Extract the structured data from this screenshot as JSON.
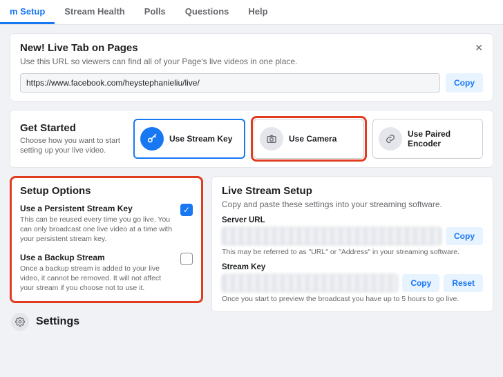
{
  "tabs": {
    "items": [
      {
        "label": "m Setup",
        "active": true
      },
      {
        "label": "Stream Health",
        "active": false
      },
      {
        "label": "Polls",
        "active": false
      },
      {
        "label": "Questions",
        "active": false
      },
      {
        "label": "Help",
        "active": false
      }
    ]
  },
  "live_tab_card": {
    "title": "New! Live Tab on Pages",
    "subtitle": "Use this URL so viewers can find all of your Page's live videos in one place.",
    "url": "https://www.facebook.com/heystephanieliu/live/",
    "copy_label": "Copy"
  },
  "get_started": {
    "title": "Get Started",
    "subtitle": "Choose how you want to start setting up your live video.",
    "options": [
      {
        "label": "Use Stream Key"
      },
      {
        "label": "Use Camera"
      },
      {
        "label": "Use Paired Encoder"
      }
    ]
  },
  "setup_options": {
    "title": "Setup Options",
    "persistent": {
      "title": "Use a Persistent Stream Key",
      "desc": "This can be reused every time you go live. You can only broadcast one live video at a time with your persistent stream key.",
      "checked": true
    },
    "backup": {
      "title": "Use a Backup Stream",
      "desc": "Once a backup stream is added to your live video, it cannot be removed. It will not affect your stream if you choose not to use it.",
      "checked": false
    }
  },
  "live_stream_setup": {
    "title": "Live Stream Setup",
    "subtitle": "Copy and paste these settings into your streaming software.",
    "server_url_label": "Server URL",
    "server_url_note": "This may be referred to as \"URL\" or \"Address\" in your streaming software.",
    "stream_key_label": "Stream Key",
    "stream_key_note": "Once you start to preview the broadcast you have up to 5 hours to go live.",
    "copy_label": "Copy",
    "reset_label": "Reset"
  },
  "settings": {
    "title": "Settings"
  }
}
